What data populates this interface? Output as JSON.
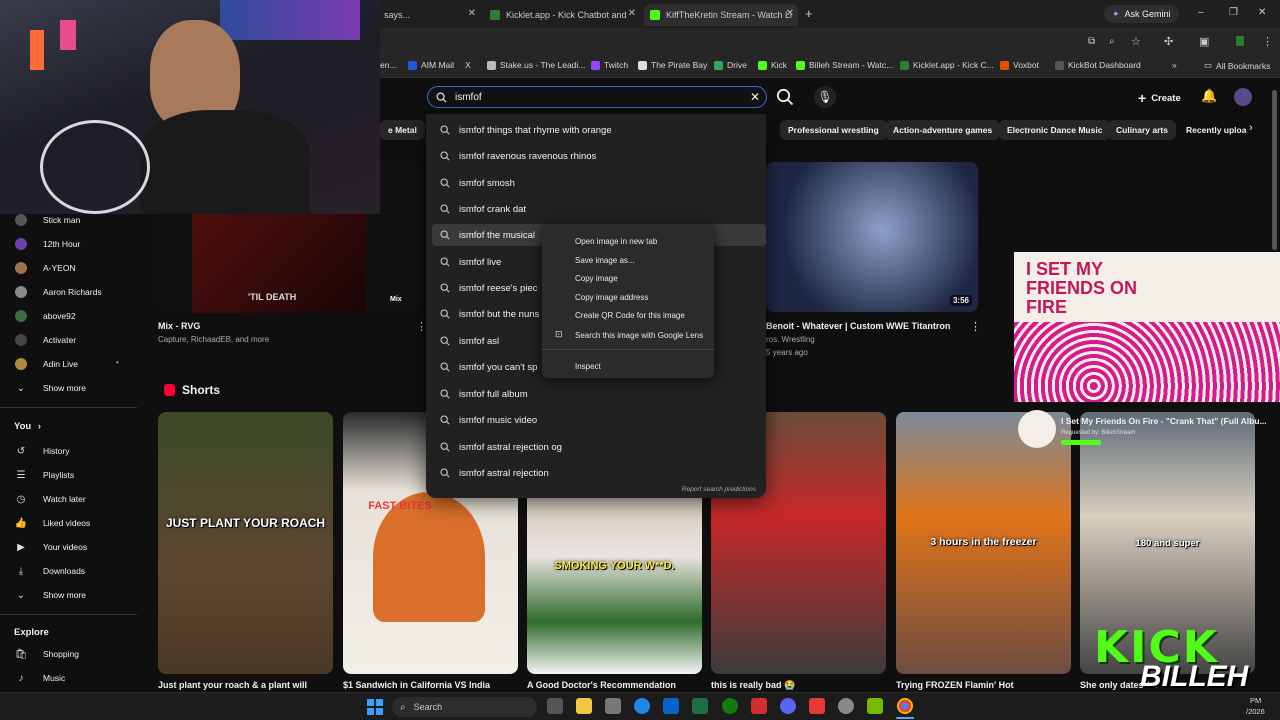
{
  "browser": {
    "tabs": [
      {
        "label": "says..."
      },
      {
        "label": "Kicklet.app - Kick Chatbot and"
      },
      {
        "label": "KiffTheKretin Stream - Watch Li"
      }
    ],
    "ask_gemini": "Ask Gemini",
    "new_tab_symbol": "+",
    "bookmarks": [
      {
        "label": "en..."
      },
      {
        "label": "AIM Mail"
      },
      {
        "label": "X"
      },
      {
        "label": "Stake.us - The Leadi..."
      },
      {
        "label": "Twitch"
      },
      {
        "label": "The Pirate Bay"
      },
      {
        "label": "Drive"
      },
      {
        "label": "Kick"
      },
      {
        "label": "Billeh Stream - Watc..."
      },
      {
        "label": "Kicklet.app - Kick C..."
      },
      {
        "label": "Voxbot"
      },
      {
        "label": "KickBot Dashboard"
      }
    ],
    "all_bookmarks": "All Bookmarks"
  },
  "youtube": {
    "search_value": "ismfof",
    "create_label": "Create",
    "chips": [
      "e Metal",
      "Professional wrestling",
      "Action-adventure games",
      "Electronic Dance Music",
      "Culinary arts",
      "Recently uploa"
    ],
    "suggestions": [
      "ismfof things that rhyme with orange",
      "ismfof ravenous ravenous rhinos",
      "ismfof smosh",
      "ismfof crank dat",
      "ismfof the musical",
      "ismfof live",
      "ismfof reese's piec",
      "ismfof but the nuns",
      "ismfof asl",
      "ismfof you can't sp",
      "ismfof full album",
      "ismfof music video",
      "ismfof astral rejection og",
      "ismfof astral rejection"
    ],
    "report_predictions": "Report search predictions",
    "context_menu": [
      "Open image in new tab",
      "Save image as...",
      "Copy image",
      "Copy image address",
      "Create QR Code for this image",
      "Search this image with Google Lens",
      "Inspect"
    ],
    "sidebar": {
      "subscriptions": [
        "Stick man",
        "12th Hour",
        "A-YEON",
        "Aaron Richards",
        "above92",
        "Activater",
        "Adin Live"
      ],
      "show_more_1": "Show more",
      "you_header": "You",
      "you_items": [
        "History",
        "Playlists",
        "Watch later",
        "Liked videos",
        "Your videos",
        "Downloads"
      ],
      "show_more_2": "Show more",
      "explore_header": "Explore",
      "explore_items": [
        "Shopping",
        "Music"
      ]
    },
    "videos": [
      {
        "title": "Mix - RVG",
        "meta": "Capture, RichaadEB, and more",
        "thumb_caption": "'TIL DEATH",
        "badge": "Mix"
      },
      {
        "title": "Benoit - Whatever | Custom WWE Titantron",
        "meta_line1": "ros. Wrestling",
        "meta_line2": "5 years ago",
        "duration": "3:56"
      },
      {
        "art_text": "I SET MY FRIENDS ON FIRE"
      }
    ],
    "shorts_header": "Shorts",
    "shorts": [
      {
        "caption": "JUST PLANT YOUR ROACH",
        "title": "Just plant your roach & a plant will"
      },
      {
        "caption": "FAST BITES",
        "title": "$1 Sandwich in California VS India"
      },
      {
        "caption": "SMOKING YOUR W**D.",
        "title": "A Good Doctor's Recommendation"
      },
      {
        "caption": "",
        "title": "this is really bad 😭"
      },
      {
        "caption": "3 hours in the freezer",
        "title": "Trying FROZEN Flamin' Hot"
      },
      {
        "caption": "180 and super",
        "title": "She only dates fat"
      }
    ],
    "now_playing_overlay": "I Set My Friends On Fire - \"Crank That\" (Full Albu...",
    "now_playing_sub": "Requested by: BillehStream"
  },
  "overlay": {
    "kick_logo": "KICK",
    "billeh_logo": "BILLEH"
  },
  "taskbar": {
    "search_label": "Search",
    "time": "PM",
    "date": "/2026"
  },
  "colors": {
    "accent_blue": "#3a6fd8",
    "youtube_red": "#ff0033",
    "kick_green": "#53fc18"
  }
}
